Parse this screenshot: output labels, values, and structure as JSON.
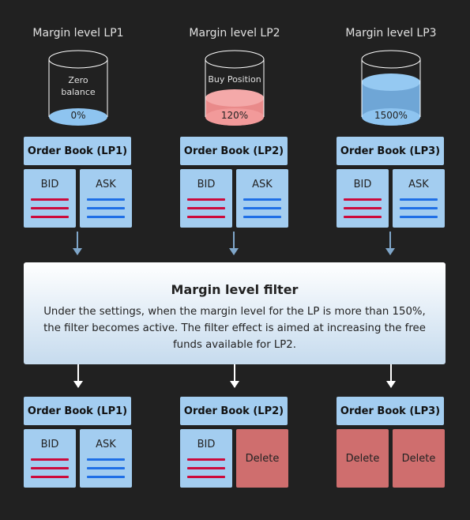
{
  "columns": [
    {
      "title": "Margin level LP1",
      "cylinder_text": "Zero balance",
      "cylinder_text_lines": [
        "Zero",
        "balance"
      ],
      "level": "0%",
      "fill": "none",
      "fill_color": "#8ec4f0"
    },
    {
      "title": "Margin level LP2",
      "cylinder_text": "Buy Position",
      "cylinder_text_lines": [
        "Buy Position"
      ],
      "level": "120%",
      "fill": "partial",
      "fill_color": "#f29a9a"
    },
    {
      "title": "Margin level LP3",
      "cylinder_text": "",
      "cylinder_text_lines": [],
      "level": "1500%",
      "fill": "high",
      "fill_color": "#8ec4f0"
    }
  ],
  "order_books_before": [
    {
      "title": "Order Book (LP1)",
      "left": {
        "label": "BID",
        "type": "bid"
      },
      "right": {
        "label": "ASK",
        "type": "ask"
      }
    },
    {
      "title": "Order Book (LP2)",
      "left": {
        "label": "BID",
        "type": "bid"
      },
      "right": {
        "label": "ASK",
        "type": "ask"
      }
    },
    {
      "title": "Order Book (LP3)",
      "left": {
        "label": "BID",
        "type": "bid"
      },
      "right": {
        "label": "ASK",
        "type": "ask"
      }
    }
  ],
  "filter": {
    "title": "Margin level filter",
    "description": "Under the settings, when the margin level for the LP is more than 150%, the filter becomes active. The filter effect is aimed at increasing the free funds available for LP2."
  },
  "order_books_after": [
    {
      "title": "Order Book (LP1)",
      "left": {
        "label": "BID",
        "type": "bid"
      },
      "right": {
        "label": "ASK",
        "type": "ask"
      }
    },
    {
      "title": "Order Book (LP2)",
      "left": {
        "label": "BID",
        "type": "bid"
      },
      "right": {
        "label": "Delete",
        "type": "delete"
      }
    },
    {
      "title": "Order Book (LP3)",
      "left": {
        "label": "Delete",
        "type": "delete"
      },
      "right": {
        "label": "Delete",
        "type": "delete"
      }
    }
  ],
  "colors": {
    "background": "#212121",
    "book_blue": "#a3cdf0",
    "bid_line": "#cc0a3c",
    "ask_line": "#1f6fe6",
    "delete": "#cf6e6e",
    "arrow_top": "#7fa6c9",
    "arrow_bottom": "#ffffff"
  }
}
